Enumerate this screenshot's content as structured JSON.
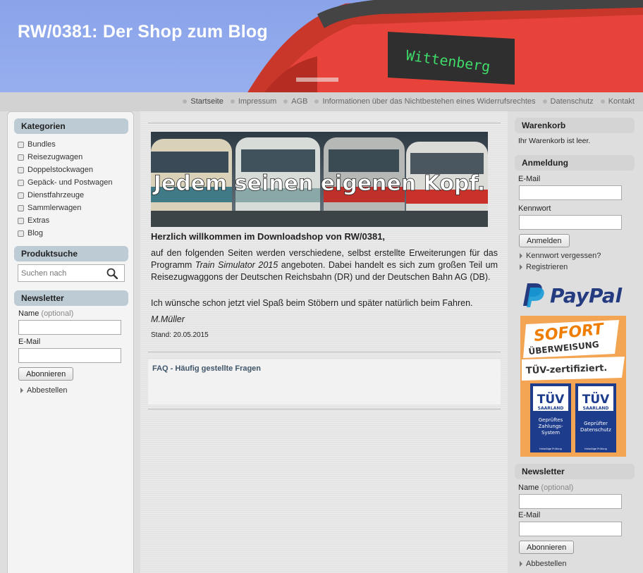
{
  "header": {
    "title": "RW/0381: Der Shop zum Blog",
    "train_destination": "Wittenberg"
  },
  "topnav": {
    "items": [
      {
        "label": "Startseite",
        "active": true
      },
      {
        "label": "Impressum"
      },
      {
        "label": "AGB"
      },
      {
        "label": "Informationen über das Nichtbestehen eines Widerrufsrechtes"
      },
      {
        "label": "Datenschutz"
      },
      {
        "label": "Kontakt"
      }
    ]
  },
  "left": {
    "categories_title": "Kategorien",
    "categories": [
      "Bundles",
      "Reisezugwagen",
      "Doppelstockwagen",
      "Gepäck- und Postwagen",
      "Dienstfahrzeuge",
      "Sammlerwagen",
      "Extras",
      "Blog"
    ],
    "search_title": "Produktsuche",
    "search_placeholder": "Suchen nach",
    "newsletter_title": "Newsletter",
    "name_label": "Name",
    "optional": "(optional)",
    "email_label": "E-Mail",
    "subscribe_button": "Abonnieren",
    "unsubscribe_link": "Abbestellen"
  },
  "main": {
    "banner_text": "Jedem seinen eigenen Kopf.",
    "welcome": "Herzlich willkommen im Downloadshop von RW/0381,",
    "intro_before": "auf den folgenden Seiten werden verschiedene, selbst erstellte Erweiterungen für das Programm ",
    "intro_product": "Train Simulator 2015",
    "intro_after": " angeboten. Dabei handelt es sich zum großen Teil um Reisezugwaggons der Deutschen Reichsbahn (DR) und der Deutschen Bahn AG (DB).",
    "wish": "Ich wünsche schon jetzt viel Spaß beim Stöbern und später natürlich beim Fahren.",
    "signature": "M.Müller",
    "stand": "Stand: 20.05.2015",
    "faq": "FAQ - Häufig gestellte Fragen"
  },
  "right": {
    "cart_title": "Warenkorb",
    "cart_status": "Ihr Warenkorb ist leer.",
    "login_title": "Anmeldung",
    "email_label": "E-Mail",
    "password_label": "Kennwort",
    "login_button": "Anmelden",
    "forgot_link": "Kennwort vergessen?",
    "register_link": "Registrieren",
    "paypal": "PayPal",
    "sofort": {
      "line1": "SOFORT",
      "line2": "ÜBERWEISUNG",
      "tuev": "TÜV-zertifiziert.",
      "seal_brand": "TÜV",
      "seal_region": "SAARLAND",
      "seal1": "Geprüftes Zahlungs-System",
      "seal2": "Geprüfter Datenschutz",
      "seal_small": "freiwillige Prüfung"
    },
    "newsletter_title": "Newsletter",
    "name_label": "Name",
    "optional": "(optional)",
    "subscribe_button": "Abonnieren",
    "unsubscribe_link": "Abbestellen"
  }
}
